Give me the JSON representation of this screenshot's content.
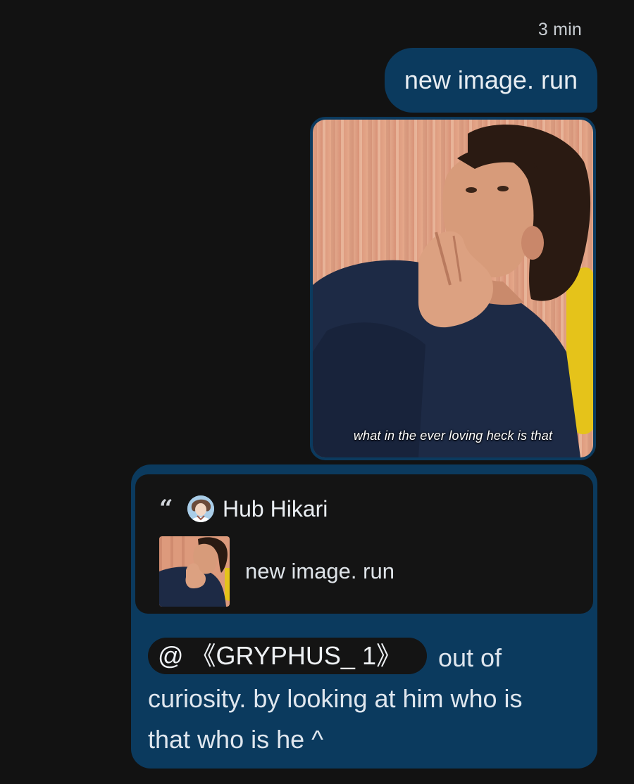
{
  "timestamp": "3 min",
  "messages": {
    "text_message": "new image. run",
    "image_caption": "what in the ever loving heck is that"
  },
  "reply": {
    "quote": {
      "author": "Hub Hikari",
      "text": "new image. run"
    },
    "mention": "@ 《GRYPHUS_ 1》",
    "body_line1": "out of",
    "body_line2": "curiosity. by looking at him who is",
    "body_line3": "that who is he ^"
  },
  "colors": {
    "background": "#121212",
    "bubble": "#0b3a5e",
    "quote_card": "#141414"
  },
  "icons": {
    "quote": "quote-icon",
    "avatar": "avatar"
  }
}
